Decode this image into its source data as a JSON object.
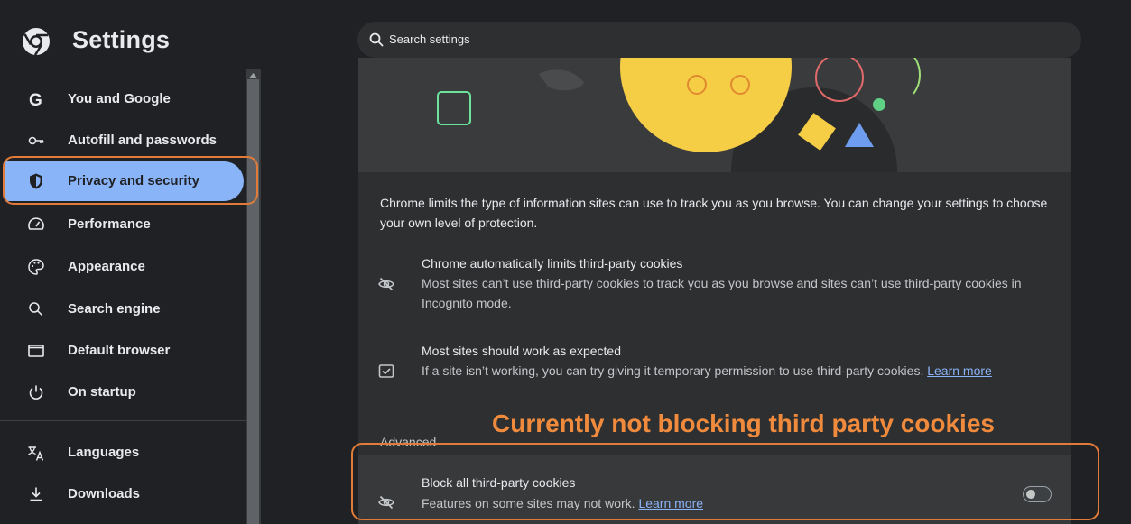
{
  "header": {
    "app_title": "Settings",
    "search_placeholder": "Search settings"
  },
  "sidebar": {
    "items": [
      {
        "label": "You and Google",
        "icon": "google-g-icon"
      },
      {
        "label": "Autofill and passwords",
        "icon": "key-icon"
      },
      {
        "label": "Privacy and security",
        "icon": "shield-icon",
        "active": true
      },
      {
        "label": "Performance",
        "icon": "speedometer-icon"
      },
      {
        "label": "Appearance",
        "icon": "palette-icon"
      },
      {
        "label": "Search engine",
        "icon": "search-icon"
      },
      {
        "label": "Default browser",
        "icon": "browser-window-icon"
      },
      {
        "label": "On startup",
        "icon": "power-icon"
      },
      {
        "label": "Languages",
        "icon": "translate-icon"
      },
      {
        "label": "Downloads",
        "icon": "download-icon"
      }
    ]
  },
  "main": {
    "description": "Chrome limits the type of information sites can use to track you as you browse. You can change your settings to choose your own level of protection.",
    "rows": [
      {
        "title": "Chrome automatically limits third-party cookies",
        "subtitle": "Most sites can’t use third-party cookies to track you as you browse and sites can’t use third-party cookies in Incognito mode.",
        "icon": "eye-off-icon"
      },
      {
        "title": "Most sites should work as expected",
        "subtitle": "If a site isn’t working, you can try giving it temporary permission to use third-party cookies.",
        "link": "Learn more",
        "icon": "checkbox-icon"
      }
    ],
    "advanced_label": "Advanced",
    "block_row": {
      "title": "Block all third-party cookies",
      "subtitle": "Features on some sites may not work.",
      "link": "Learn more",
      "icon": "eye-off-icon",
      "toggle_on": false
    }
  },
  "annotation": {
    "text": "Currently not blocking third party cookies",
    "color": "#e07b39"
  },
  "colors": {
    "background": "#202124",
    "accent": "#8ab4f8",
    "panel": "#2e2f31"
  }
}
